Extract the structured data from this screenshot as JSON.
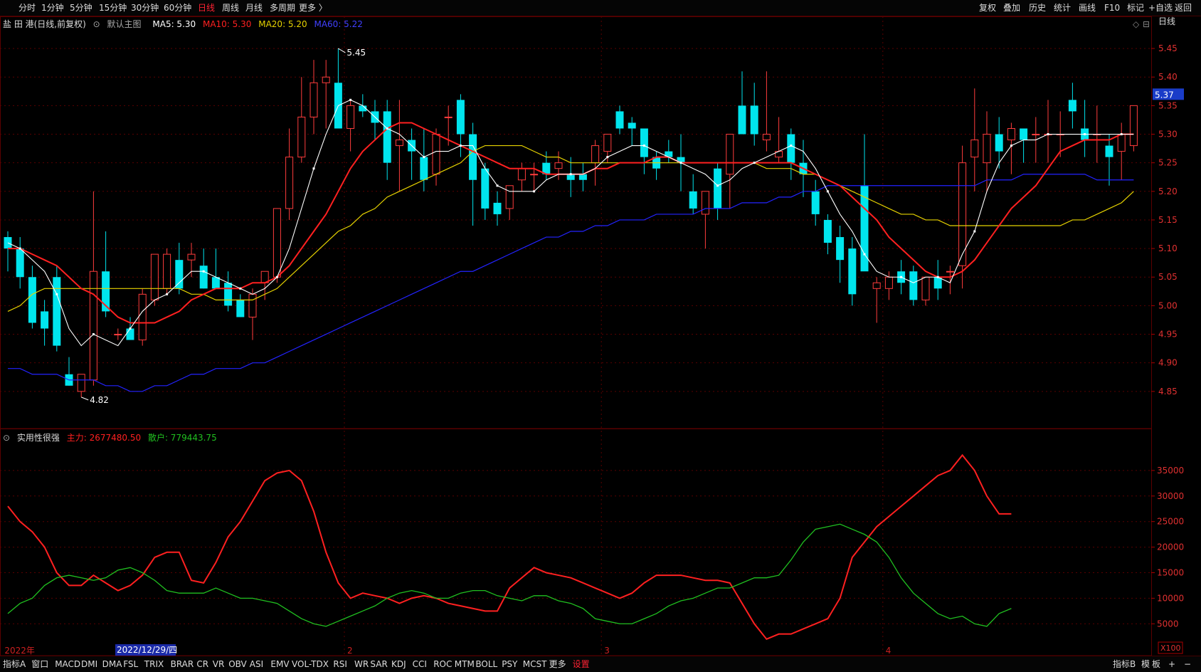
{
  "toolbar": {
    "left": [
      "分时",
      "1分钟",
      "5分钟",
      "15分钟",
      "30分钟",
      "60分钟",
      "日线",
      "周线",
      "月线",
      "多周期",
      "更多 〉"
    ],
    "active": "日线",
    "right": [
      "复权",
      "叠加",
      "历史",
      "统计",
      "画线",
      "F10",
      "标记",
      "+自选",
      "返回"
    ]
  },
  "bottombar": {
    "left": [
      "指标A",
      "窗口",
      "MACD",
      "DMI",
      "DMA",
      "FSL",
      "TRIX",
      "BRAR",
      "CR",
      "VR",
      "OBV",
      "ASI",
      "EMV",
      "VOL-TDX",
      "RSI",
      "WR",
      "SAR",
      "KDJ",
      "CCI",
      "ROC",
      "MTM",
      "BOLL",
      "PSY",
      "MCST",
      "更多",
      "设置"
    ],
    "setting": "设置",
    "right": [
      "指标B",
      "模",
      "板",
      "+",
      "−"
    ]
  },
  "main_legend": {
    "stock": "盐 田 港(日线,前复权)",
    "template": "默认主图",
    "ma5": "MA5: 5.30",
    "ma10": "MA10: 5.30",
    "ma20": "MA20: 5.20",
    "ma60": "MA60: 5.22"
  },
  "sub_legend": {
    "name": "实用性很强",
    "main_force": "主力: 2677480.50",
    "retail": "散户: 779443.75"
  },
  "period_label": "日线",
  "x100_label": "X100",
  "cursor_date": "2022/12/29/四",
  "x_axis_labels": [
    {
      "label": "2022年",
      "i": 0
    },
    {
      "label": "2",
      "i": 28
    },
    {
      "label": "3",
      "i": 49
    },
    {
      "label": "4",
      "i": 72
    }
  ],
  "colors": {
    "up": "#ff3c3c",
    "down": "#00e5ee",
    "ma5": "#ffffff",
    "ma10": "#ff2020",
    "ma20": "#e6d200",
    "ma60": "#2323ff",
    "main_force": "#ff2020",
    "retail": "#20c020",
    "grid": "#5a0000"
  },
  "chart_data": [
    {
      "type": "candlestick",
      "title": "盐 田 港(日线,前复权)",
      "y_ticks": [
        4.85,
        4.9,
        4.95,
        5.0,
        5.05,
        5.1,
        5.15,
        5.2,
        5.25,
        5.3,
        5.35,
        5.4,
        5.45
      ],
      "ylim": [
        4.79,
        5.48
      ],
      "current_price": "5.37",
      "high_label": "5.45",
      "low_label": "4.82",
      "candles": [
        [
          5.12,
          5.13,
          5.06,
          5.1
        ],
        [
          5.1,
          5.12,
          5.03,
          5.05
        ],
        [
          5.05,
          5.07,
          4.96,
          4.97
        ],
        [
          4.99,
          5.01,
          4.93,
          4.96
        ],
        [
          5.05,
          5.07,
          4.92,
          4.93
        ],
        [
          4.88,
          4.91,
          4.86,
          4.86
        ],
        [
          4.85,
          4.88,
          4.84,
          4.88
        ],
        [
          4.87,
          5.2,
          4.86,
          5.06
        ],
        [
          5.06,
          5.13,
          4.98,
          4.99
        ],
        [
          4.95,
          4.96,
          4.94,
          4.95
        ],
        [
          4.96,
          4.98,
          4.95,
          4.94
        ],
        [
          4.94,
          5.03,
          4.93,
          5.02
        ],
        [
          5.01,
          5.09,
          5.0,
          5.09
        ],
        [
          5.03,
          5.1,
          5.02,
          5.09
        ],
        [
          5.08,
          5.11,
          5.02,
          5.03
        ],
        [
          5.08,
          5.11,
          5.05,
          5.09
        ],
        [
          5.07,
          5.1,
          5.03,
          5.03
        ],
        [
          5.05,
          5.1,
          5.03,
          5.03
        ],
        [
          5.04,
          5.06,
          4.99,
          5.0
        ],
        [
          5.01,
          5.02,
          4.98,
          4.98
        ],
        [
          4.98,
          5.03,
          4.94,
          5.02
        ],
        [
          5.04,
          5.06,
          5.01,
          5.06
        ],
        [
          5.05,
          5.17,
          5.04,
          5.17
        ],
        [
          5.17,
          5.31,
          5.15,
          5.26
        ],
        [
          5.26,
          5.4,
          5.25,
          5.33
        ],
        [
          5.33,
          5.43,
          5.3,
          5.39
        ],
        [
          5.39,
          5.43,
          5.31,
          5.4
        ],
        [
          5.39,
          5.45,
          5.32,
          5.31
        ],
        [
          5.31,
          5.36,
          5.27,
          5.35
        ],
        [
          5.35,
          5.37,
          5.33,
          5.34
        ],
        [
          5.34,
          5.36,
          5.29,
          5.32
        ],
        [
          5.34,
          5.36,
          5.22,
          5.25
        ],
        [
          5.28,
          5.36,
          5.2,
          5.29
        ],
        [
          5.29,
          5.31,
          5.22,
          5.27
        ],
        [
          5.26,
          5.31,
          5.2,
          5.22
        ],
        [
          5.23,
          5.31,
          5.21,
          5.3
        ],
        [
          5.33,
          5.35,
          5.28,
          5.33
        ],
        [
          5.36,
          5.37,
          5.26,
          5.3
        ],
        [
          5.3,
          5.32,
          5.14,
          5.22
        ],
        [
          5.24,
          5.25,
          5.15,
          5.17
        ],
        [
          5.18,
          5.2,
          5.14,
          5.16
        ],
        [
          5.17,
          5.21,
          5.15,
          5.21
        ],
        [
          5.22,
          5.25,
          5.2,
          5.24
        ],
        [
          5.23,
          5.25,
          5.2,
          5.23
        ],
        [
          5.25,
          5.27,
          5.22,
          5.23
        ],
        [
          5.24,
          5.27,
          5.22,
          5.25
        ],
        [
          5.23,
          5.26,
          5.19,
          5.22
        ],
        [
          5.23,
          5.25,
          5.2,
          5.22
        ],
        [
          5.25,
          5.29,
          5.21,
          5.28
        ],
        [
          5.27,
          5.3,
          5.25,
          5.3
        ],
        [
          5.34,
          5.35,
          5.3,
          5.31
        ],
        [
          5.32,
          5.33,
          5.28,
          5.31
        ],
        [
          5.31,
          5.31,
          5.23,
          5.26
        ],
        [
          5.26,
          5.27,
          5.22,
          5.24
        ],
        [
          5.27,
          5.29,
          5.25,
          5.26
        ],
        [
          5.26,
          5.3,
          5.2,
          5.25
        ],
        [
          5.2,
          5.23,
          5.16,
          5.17
        ],
        [
          5.16,
          5.2,
          5.1,
          5.2
        ],
        [
          5.24,
          5.25,
          5.15,
          5.17
        ],
        [
          5.23,
          5.3,
          5.17,
          5.3
        ],
        [
          5.35,
          5.41,
          5.3,
          5.3
        ],
        [
          5.35,
          5.39,
          5.28,
          5.3
        ],
        [
          5.29,
          5.41,
          5.27,
          5.3
        ],
        [
          5.26,
          5.33,
          5.25,
          5.27
        ],
        [
          5.3,
          5.31,
          5.22,
          5.25
        ],
        [
          5.25,
          5.29,
          5.19,
          5.23
        ],
        [
          5.2,
          5.22,
          5.14,
          5.16
        ],
        [
          5.15,
          5.16,
          5.09,
          5.11
        ],
        [
          5.12,
          5.14,
          5.04,
          5.08
        ],
        [
          5.1,
          5.12,
          5.0,
          5.02
        ],
        [
          5.21,
          5.3,
          5.08,
          5.06
        ],
        [
          5.03,
          5.05,
          4.97,
          5.04
        ],
        [
          5.03,
          5.06,
          5.01,
          5.05
        ],
        [
          5.06,
          5.08,
          5.02,
          5.04
        ],
        [
          5.06,
          5.07,
          5.0,
          5.01
        ],
        [
          5.01,
          5.05,
          5.0,
          5.05
        ],
        [
          5.05,
          5.08,
          5.01,
          5.03
        ],
        [
          5.06,
          5.07,
          5.02,
          5.06
        ],
        [
          5.07,
          5.28,
          5.03,
          5.25
        ],
        [
          5.26,
          5.38,
          5.2,
          5.29
        ],
        [
          5.25,
          5.34,
          5.2,
          5.3
        ],
        [
          5.3,
          5.33,
          5.24,
          5.27
        ],
        [
          5.29,
          5.32,
          5.23,
          5.31
        ],
        [
          5.31,
          5.3,
          5.25,
          5.29
        ],
        [
          5.3,
          5.33,
          5.25,
          5.3
        ],
        [
          5.3,
          5.36,
          5.25,
          5.3
        ],
        [
          5.3,
          5.34,
          5.26,
          5.3
        ],
        [
          5.36,
          5.39,
          5.31,
          5.34
        ],
        [
          5.31,
          5.36,
          5.26,
          5.29
        ],
        [
          5.3,
          5.35,
          5.25,
          5.3
        ],
        [
          5.28,
          5.3,
          5.21,
          5.26
        ],
        [
          5.27,
          5.32,
          5.22,
          5.3
        ],
        [
          5.28,
          5.35,
          5.27,
          5.35
        ]
      ],
      "ma5": [
        5.11,
        5.1,
        5.08,
        5.06,
        5.02,
        4.96,
        4.93,
        4.95,
        4.94,
        4.93,
        4.96,
        4.99,
        5.01,
        5.02,
        5.04,
        5.06,
        5.06,
        5.05,
        5.04,
        5.03,
        5.02,
        5.03,
        5.05,
        5.1,
        5.17,
        5.24,
        5.3,
        5.35,
        5.36,
        5.35,
        5.33,
        5.31,
        5.3,
        5.28,
        5.26,
        5.27,
        5.27,
        5.28,
        5.28,
        5.24,
        5.21,
        5.2,
        5.2,
        5.2,
        5.22,
        5.23,
        5.23,
        5.23,
        5.24,
        5.26,
        5.27,
        5.28,
        5.28,
        5.27,
        5.26,
        5.25,
        5.24,
        5.23,
        5.21,
        5.22,
        5.24,
        5.25,
        5.26,
        5.27,
        5.28,
        5.27,
        5.24,
        5.2,
        5.16,
        5.13,
        5.09,
        5.06,
        5.05,
        5.05,
        5.04,
        5.05,
        5.05,
        5.04,
        5.09,
        5.13,
        5.2,
        5.25,
        5.28,
        5.29,
        5.29,
        5.3,
        5.3,
        5.3,
        5.3,
        5.3,
        5.3,
        5.3,
        5.3
      ],
      "ma10": [
        5.1,
        5.1,
        5.09,
        5.08,
        5.07,
        5.05,
        5.03,
        5.02,
        5.0,
        4.98,
        4.97,
        4.97,
        4.97,
        4.98,
        4.99,
        5.01,
        5.02,
        5.03,
        5.03,
        5.03,
        5.04,
        5.04,
        5.05,
        5.07,
        5.1,
        5.13,
        5.16,
        5.2,
        5.24,
        5.27,
        5.29,
        5.31,
        5.32,
        5.32,
        5.31,
        5.3,
        5.29,
        5.28,
        5.27,
        5.26,
        5.25,
        5.24,
        5.24,
        5.24,
        5.23,
        5.23,
        5.23,
        5.23,
        5.24,
        5.24,
        5.25,
        5.25,
        5.25,
        5.26,
        5.26,
        5.25,
        5.25,
        5.25,
        5.25,
        5.25,
        5.25,
        5.25,
        5.25,
        5.25,
        5.25,
        5.24,
        5.23,
        5.22,
        5.21,
        5.19,
        5.17,
        5.15,
        5.12,
        5.1,
        5.08,
        5.06,
        5.05,
        5.05,
        5.06,
        5.08,
        5.11,
        5.14,
        5.17,
        5.19,
        5.21,
        5.24,
        5.27,
        5.28,
        5.29,
        5.29,
        5.29,
        5.3,
        5.3
      ],
      "ma20": [
        4.99,
        5.0,
        5.02,
        5.03,
        5.03,
        5.03,
        5.03,
        5.03,
        5.03,
        5.03,
        5.03,
        5.03,
        5.03,
        5.03,
        5.03,
        5.02,
        5.02,
        5.01,
        5.01,
        5.01,
        5.01,
        5.02,
        5.03,
        5.05,
        5.07,
        5.09,
        5.11,
        5.13,
        5.14,
        5.16,
        5.17,
        5.19,
        5.2,
        5.21,
        5.22,
        5.23,
        5.24,
        5.25,
        5.27,
        5.28,
        5.28,
        5.28,
        5.28,
        5.27,
        5.26,
        5.26,
        5.25,
        5.25,
        5.25,
        5.25,
        5.25,
        5.25,
        5.25,
        5.25,
        5.25,
        5.25,
        5.25,
        5.25,
        5.25,
        5.25,
        5.25,
        5.25,
        5.24,
        5.24,
        5.24,
        5.23,
        5.23,
        5.22,
        5.21,
        5.2,
        5.19,
        5.18,
        5.17,
        5.16,
        5.16,
        5.15,
        5.15,
        5.14,
        5.14,
        5.14,
        5.14,
        5.14,
        5.14,
        5.14,
        5.14,
        5.14,
        5.14,
        5.15,
        5.15,
        5.16,
        5.17,
        5.18,
        5.2
      ],
      "ma60": [
        4.89,
        4.89,
        4.88,
        4.88,
        4.88,
        4.87,
        4.87,
        4.87,
        4.86,
        4.86,
        4.85,
        4.85,
        4.86,
        4.86,
        4.87,
        4.88,
        4.88,
        4.89,
        4.89,
        4.89,
        4.9,
        4.9,
        4.91,
        4.92,
        4.93,
        4.94,
        4.95,
        4.96,
        4.97,
        4.98,
        4.99,
        5.0,
        5.01,
        5.02,
        5.03,
        5.04,
        5.05,
        5.06,
        5.06,
        5.07,
        5.08,
        5.09,
        5.1,
        5.11,
        5.12,
        5.12,
        5.13,
        5.13,
        5.14,
        5.14,
        5.15,
        5.15,
        5.15,
        5.16,
        5.16,
        5.16,
        5.16,
        5.17,
        5.17,
        5.17,
        5.18,
        5.18,
        5.18,
        5.19,
        5.19,
        5.2,
        5.2,
        5.21,
        5.21,
        5.21,
        5.21,
        5.21,
        5.21,
        5.21,
        5.21,
        5.21,
        5.21,
        5.21,
        5.21,
        5.21,
        5.22,
        5.22,
        5.22,
        5.23,
        5.23,
        5.23,
        5.23,
        5.23,
        5.23,
        5.22,
        5.22,
        5.22,
        5.22
      ]
    },
    {
      "type": "line",
      "title": "实用性很强",
      "y_ticks": [
        5000,
        10000,
        15000,
        20000,
        25000,
        30000,
        35000
      ],
      "ylim": [
        1000,
        40000
      ],
      "series": [
        {
          "name": "主力",
          "values": [
            28000,
            25000,
            23000,
            20000,
            15000,
            12500,
            12500,
            14500,
            13000,
            11500,
            12500,
            14500,
            18000,
            19000,
            19000,
            13500,
            13000,
            17000,
            22000,
            25000,
            29000,
            33000,
            34500,
            35000,
            33000,
            27000,
            19000,
            13000,
            10000,
            11000,
            10500,
            10000,
            9000,
            10000,
            10500,
            10000,
            9000,
            8500,
            8000,
            7500,
            7500,
            12000,
            14000,
            16000,
            15000,
            14500,
            14000,
            13000,
            12000,
            11000,
            10000,
            11000,
            13000,
            14500,
            14500,
            14500,
            14000,
            13500,
            13500,
            13000,
            9000,
            5000,
            2000,
            3000,
            3000,
            4000,
            5000,
            6000,
            10000,
            18000,
            21000,
            24000,
            26000,
            28000,
            30000,
            32000,
            34000,
            35000,
            38000,
            35000,
            30000,
            26500,
            26500
          ]
        },
        {
          "name": "散户",
          "values": [
            7000,
            9000,
            10000,
            12500,
            14000,
            14500,
            14000,
            13500,
            14000,
            15500,
            16000,
            15000,
            13500,
            11500,
            11000,
            11000,
            11000,
            12000,
            11000,
            10000,
            10000,
            9500,
            9000,
            7500,
            6000,
            5000,
            4500,
            5500,
            6500,
            7500,
            8500,
            10000,
            11000,
            11500,
            11000,
            10000,
            10000,
            11000,
            11500,
            11500,
            10500,
            10000,
            9500,
            10500,
            10500,
            9500,
            9000,
            8000,
            6000,
            5500,
            5000,
            5000,
            6000,
            7000,
            8500,
            9500,
            10000,
            11000,
            12000,
            12000,
            13000,
            14000,
            14000,
            14500,
            17500,
            21000,
            23500,
            24000,
            24500,
            23500,
            22500,
            21000,
            18000,
            14000,
            11000,
            9000,
            7000,
            6000,
            6500,
            5000,
            4500,
            7000,
            8000
          ]
        }
      ]
    }
  ]
}
